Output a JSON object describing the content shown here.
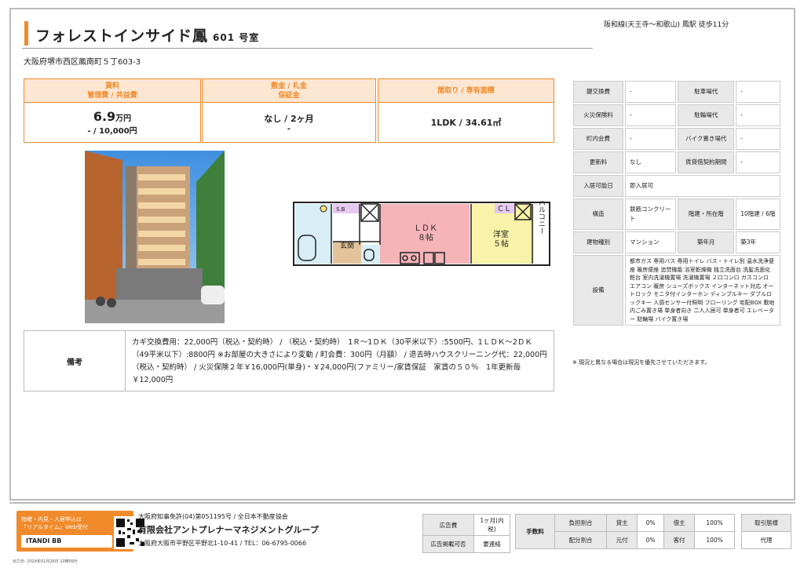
{
  "header": {
    "title": "フォレストインサイド鳳",
    "room": "601 号室",
    "access": "阪和線(天王寺～和歌山) 鳳駅 徒歩11分",
    "address": "大阪府堺市西区鳳南町５丁603-3"
  },
  "price": {
    "rent_head1": "賃料",
    "rent_head2": "管理費 / 共益費",
    "rent_value": "6.9",
    "rent_unit": "万円",
    "mgmt_fee": "- / 10,000円",
    "deposit_head1": "敷金 / 礼金",
    "deposit_head2": "保証金",
    "deposit_value": "なし / 2ヶ月",
    "guarantee_value": "-",
    "layout_head": "間取り / 専有面積",
    "layout_value": "1LDK / 34.61㎡"
  },
  "floorplan": {
    "sb": "S.B",
    "ldk": "ＬＤＫ",
    "ldk_size": "８帖",
    "cl": "ＣＬ",
    "western": "洋室",
    "western_size": "５帖",
    "genkan": "玄関",
    "balcony": "バルコニー"
  },
  "notes": {
    "label": "備考",
    "text": "カギ交換費用：22,000円（税込・契約時） / （税込・契約時）　1Ｒ～1ＤＫ（30平米以下）:5500円、1ＬＤＫ～2ＤＫ（49平米以下）:8800円 ※お部屋の大きさにより変動 / 町会費：300円（月額） / 退去時ハウスクリーニング代：22,000円（税込・契約時） / 火災保険２年￥16,000円(単身)・￥24,000円(ファミリー/家賃保証　家賃の５０％　1年更新毎￥12,000円"
  },
  "spec": {
    "rows": [
      {
        "k1": "鍵交換費",
        "v1": "-",
        "k2": "駐車場代",
        "v2": "-"
      },
      {
        "k1": "火災保険料",
        "v1": "-",
        "k2": "駐輪場代",
        "v2": "-"
      },
      {
        "k1": "町内会費",
        "v1": "-",
        "k2": "バイク置き場代",
        "v2": "-"
      },
      {
        "k1": "更新料",
        "v1": "なし",
        "k2": "賃貸借契約期間",
        "v2": "-"
      }
    ],
    "movein_label": "入居可能日",
    "movein_value": "即入居可",
    "structure_label": "構造",
    "structure_value": "鉄筋コンクリート",
    "floor_label": "階建・所在階",
    "floor_value": "10階建 / 6階",
    "type_label": "建物種別",
    "type_value": "マンション",
    "age_label": "築年月",
    "age_value": "築3年",
    "equip_label": "設備",
    "equip_value": "都市ガス 専用バス 専用トイレ バス・トイレ別 温水洗浄便座 暖房便座 追焚機能 浴室乾燥機 独立洗面台 洗髪洗面化粧台 室内洗濯機置場 洗濯機置場 ２口コンロ ガスコンロ エアコン 暖房 シューズボックス インターネット対応 オートロック モニタ付インターホン ディンプルキー ダブルロックキー 人感センサー付照明 フローリング 宅配BOX 敷地内ごみ置き場 単身者向き 二人入居可 単身者可 エレベーター 駐輪場 バイク置き場",
    "note": "※ 現況と異なる場合は現況を優先させていただきます。"
  },
  "footer": {
    "itandi_text": "物確・内見・入居申込は「リアルタイム」Web受付",
    "itandi_brand": "ITANDI BB",
    "license": "大阪府知事免許(04)第051195号 / 全日本不動産協会",
    "company": "有限会社アントプレナーマネジメントグループ",
    "company_addr": "大阪府大阪市平野区平野北1-10-41 / TEL：06-6795-0066",
    "ad_fee_label": "広告費",
    "ad_fee_value": "1ヶ月(内税)",
    "ad_allow_label": "広告掲載可否",
    "ad_allow_value": "要連絡",
    "commission_label": "手数料",
    "burden_label": "負担割合",
    "dist_label": "配分割合",
    "lessor": "貸主",
    "lessor_pct": "0%",
    "origin": "元付",
    "origin_pct": "0%",
    "lessee": "借主",
    "lessee_pct": "100%",
    "client": "客付",
    "client_pct": "100%",
    "deal_label": "取引態様",
    "deal_value": "代理",
    "printed": "出力日: 2024年01月26日 10時09分"
  }
}
